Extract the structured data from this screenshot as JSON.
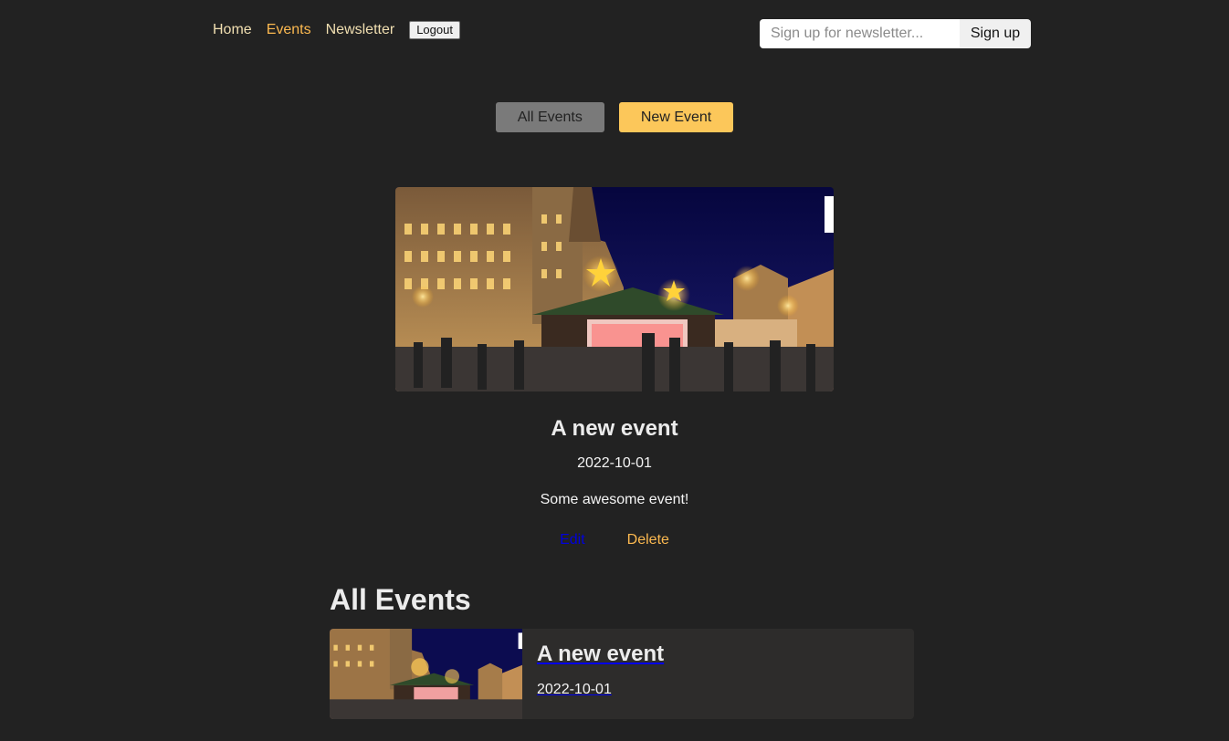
{
  "header": {
    "nav": {
      "home": "Home",
      "events": "Events",
      "newsletter": "Newsletter",
      "logout": "Logout"
    },
    "newsletter_form": {
      "placeholder": "Sign up for newsletter...",
      "button": "Sign up"
    }
  },
  "events_nav": {
    "all_events": "All Events",
    "new_event": "New Event"
  },
  "event_detail": {
    "title": "A new event",
    "date": "2022-10-01",
    "description": "Some awesome event!",
    "edit_label": "Edit",
    "delete_label": "Delete"
  },
  "events_list": {
    "heading": "All Events",
    "items": [
      {
        "title": "A new event",
        "date": "2022-10-01"
      }
    ]
  },
  "colors": {
    "background": "#222222",
    "accent": "#fcb950",
    "new_event_button": "#fcc75a",
    "edit_link": "#0000dd"
  }
}
